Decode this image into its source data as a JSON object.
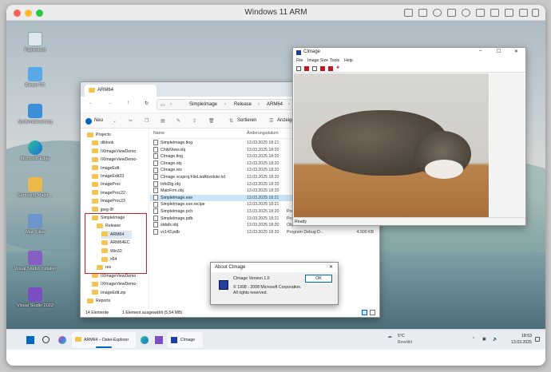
{
  "vm": {
    "title": "Windows 11 ARM"
  },
  "desktop": {
    "icons": [
      "Papierkorb",
      "Dieser PC",
      "Systemsteuerung",
      "Microsoft Edge",
      "Samsung Magic...",
      "Mac Files",
      "Visual Studio Installer",
      "Visual Studio 2022"
    ]
  },
  "explorer": {
    "tab": "ARM64",
    "breadcrumb": [
      "SimpleImage",
      "Release",
      "ARM64"
    ],
    "new_label": "Neu",
    "sort_label": "Sortieren",
    "view_label": "Anzeigen",
    "col_name": "Name",
    "col_date": "Änderungsdatum",
    "nav": [
      {
        "label": "Projects",
        "level": 0
      },
      {
        "label": "diblook",
        "level": 1
      },
      {
        "label": "IXImageViewDemo",
        "level": 1
      },
      {
        "label": "IXImageViewDemo-",
        "level": 1
      },
      {
        "label": "ImageEdit",
        "level": 1
      },
      {
        "label": "ImageEdit23",
        "level": 1
      },
      {
        "label": "ImageProc",
        "level": 1
      },
      {
        "label": "ImageProc22",
        "level": 1
      },
      {
        "label": "ImageProc23",
        "level": 1
      },
      {
        "label": "jpeg-9f",
        "level": 1
      },
      {
        "label": "SimpleImage",
        "level": 1
      },
      {
        "label": "Release",
        "level": 2
      },
      {
        "label": "ARM64",
        "level": 3
      },
      {
        "label": "ARM64EC",
        "level": 3
      },
      {
        "label": "Win32",
        "level": 3
      },
      {
        "label": "x64",
        "level": 3
      },
      {
        "label": "res",
        "level": 2
      },
      {
        "label": "IXImageViewDemo",
        "level": 1
      },
      {
        "label": "IXImageViewDemo-",
        "level": 1
      },
      {
        "label": "ImageEdit.zip",
        "level": 1
      },
      {
        "label": "Reports",
        "level": 0
      }
    ],
    "files": [
      {
        "name": "SimpleImage.tlog",
        "date": "13.03.2025 18:21",
        "type": "",
        "size": ""
      },
      {
        "name": "ChildView.obj",
        "date": "13.03.2025 18:20",
        "type": "",
        "size": ""
      },
      {
        "name": "CImage.tlog",
        "date": "13.03.2025 18:20",
        "type": "",
        "size": ""
      },
      {
        "name": "CImage.obj",
        "date": "13.03.2025 18:20",
        "type": "",
        "size": ""
      },
      {
        "name": "CImage.res",
        "date": "13.03.2025 18:20",
        "type": "",
        "size": ""
      },
      {
        "name": "CImage.vcxproj.FileListAbsolute.txt",
        "date": "13.03.2025 18:20",
        "type": "",
        "size": ""
      },
      {
        "name": "InfoDlg.obj",
        "date": "13.03.2025 18:20",
        "type": "",
        "size": ""
      },
      {
        "name": "MainFrm.obj",
        "date": "13.03.2025 18:20",
        "type": "",
        "size": ""
      },
      {
        "name": "SimpleImage.exe",
        "date": "13.03.2025 18:21",
        "type": "",
        "size": ""
      },
      {
        "name": "SimpleImage.exe.recipe",
        "date": "13.03.2025 18:21",
        "type": "",
        "size": ""
      },
      {
        "name": "SimpleImage.pch",
        "date": "13.03.2025 18:20",
        "type": "Precompiled Hea...",
        "size": "37.312 KB"
      },
      {
        "name": "SimpleImage.pdb",
        "date": "13.03.2025 18:21",
        "type": "Program Debug D...",
        "size": "36.908 KB"
      },
      {
        "name": "stdafx.obj",
        "date": "13.03.2025 18:20",
        "type": "Object File",
        "size": "530 KB"
      },
      {
        "name": "vc143.pdb",
        "date": "13.03.2025 18:20",
        "type": "Program Debug D...",
        "size": "4.500 KB"
      }
    ],
    "status_count": "14 Elemente",
    "status_selected": "1 Element ausgewählt (5,54 MB)"
  },
  "cimage": {
    "title": "CImage",
    "menu": [
      "File",
      "Image Size",
      "Tools",
      "Help"
    ],
    "status": "Ready"
  },
  "about": {
    "title": "About CImage",
    "version": "CImage Version 1.0",
    "copyright": "© 1998 - 2008 Microsoft Corporation.",
    "rights": "All rights reserved.",
    "ok_label": "OK",
    "close_glyph": "✕"
  },
  "taskbar": {
    "explorer_label": "ARM64 – Datei-Explorer",
    "cimage_label": "CImage",
    "weather_temp": "5°C",
    "weather_desc": "Bewölkt",
    "time": "18:53",
    "date": "13.03.2025"
  },
  "colors": {
    "accent": "#0067c0",
    "highlight_box": "#d0202a",
    "tool_red": "#c8141e"
  }
}
